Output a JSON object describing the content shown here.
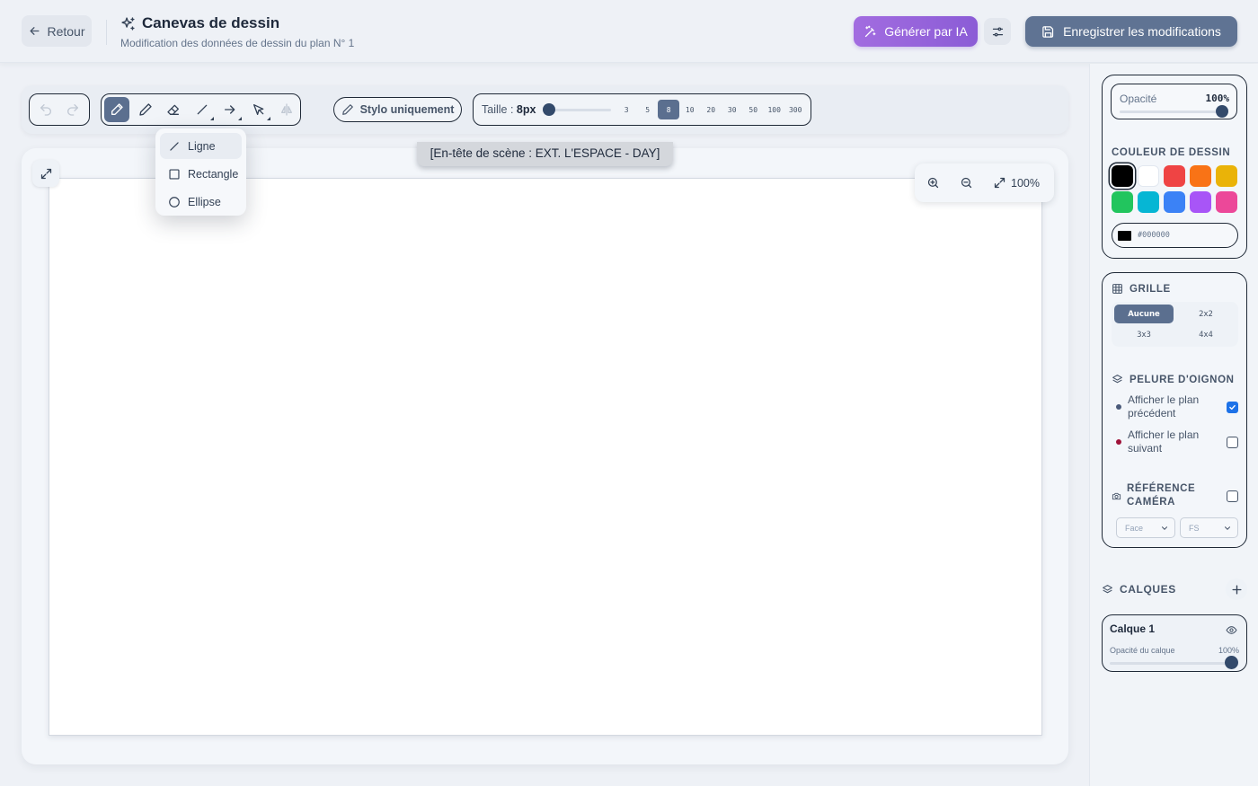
{
  "header": {
    "back_label": "Retour",
    "title": "Canevas de dessin",
    "subtitle": "Modification des données de dessin du plan N° 1",
    "ai_label": "Générer par IA",
    "save_label": "Enregistrer les modifications"
  },
  "toolbar": {
    "tools": [
      {
        "name": "brush-icon",
        "active": true
      },
      {
        "name": "pencil-icon",
        "active": false
      },
      {
        "name": "eraser-icon",
        "active": false
      },
      {
        "name": "line-tool-icon",
        "active": false
      },
      {
        "name": "arrow-tool-icon",
        "active": false
      },
      {
        "name": "select-tool-icon",
        "active": false
      },
      {
        "name": "flip-icon",
        "active": false
      }
    ],
    "pen_only_label": "Stylo uniquement",
    "size_label": "Taille : ",
    "size_value": "8px",
    "size_options": [
      "3",
      "5",
      "8",
      "10",
      "20",
      "30",
      "50",
      "100",
      "300"
    ],
    "size_selected": "8"
  },
  "shape_menu": {
    "items": [
      "Ligne",
      "Rectangle",
      "Ellipse"
    ],
    "selected": "Ligne"
  },
  "canvas": {
    "scene_header": "[En-tête de scène : EXT. L'ESPACE - DAY]",
    "zoom_label": "100%"
  },
  "panel": {
    "opacity_label": "Opacité",
    "opacity_value": "100%",
    "color_title": "COULEUR DE DESSIN",
    "colors": [
      "#000000",
      "#ffffff",
      "#ef4444",
      "#f97316",
      "#eab308",
      "#22c55e",
      "#06b6d4",
      "#3b82f6",
      "#a855f7",
      "#ec4899"
    ],
    "selected_color": "#000000",
    "hex_value": "#000000",
    "grid_title": "GRILLE",
    "grid_options": [
      "Aucune",
      "2x2",
      "3x3",
      "4x4"
    ],
    "grid_selected": "Aucune",
    "onion_title": "PELURE D'OIGNON",
    "onion_prev": "Afficher le plan précédent",
    "onion_next": "Afficher le plan suivant",
    "onion_prev_checked": true,
    "onion_next_checked": false,
    "onion_prev_color": "#4a5a7a",
    "onion_next_color": "#9f1239",
    "camera_title": "RÉFÉRENCE CAMÉRA",
    "camera_checked": false,
    "camera_angle": "Face",
    "camera_shot": "FS",
    "layers_title": "CALQUES",
    "layer_name": "Calque 1",
    "layer_opacity_label": "Opacité du calque",
    "layer_opacity_value": "100%"
  }
}
